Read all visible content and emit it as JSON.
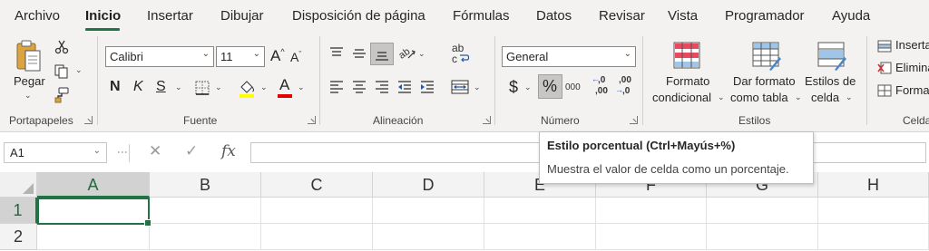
{
  "tabs": [
    "Archivo",
    "Inicio",
    "Insertar",
    "Dibujar",
    "Disposición de página",
    "Fórmulas",
    "Datos",
    "Revisar",
    "Vista",
    "Programador",
    "Ayuda"
  ],
  "active_tab": "Inicio",
  "clipboard": {
    "paste_label": "Pegar",
    "group_label": "Portapapeles"
  },
  "font": {
    "name": "Calibri",
    "size": "11",
    "bold": "N",
    "italic": "K",
    "underline": "S",
    "font_color": "A",
    "grow": "A",
    "shrink": "A",
    "group_label": "Fuente",
    "highlight_color": "#ffff00",
    "font_color_value": "#e00000"
  },
  "alignment": {
    "wrap_glyph": "ab",
    "wrap_glyph2": "c",
    "group_label": "Alineación"
  },
  "number": {
    "format": "General",
    "currency": "$",
    "percent": "%",
    "thousands": "000",
    "inc_decimal_top": ",0",
    "inc_decimal_bottom": ",00",
    "dec_decimal_top": ",00",
    "dec_decimal_bottom": ",0",
    "group_label": "Número"
  },
  "styles": {
    "conditional_label_1": "Formato",
    "conditional_label_2": "condicional",
    "table_label_1": "Dar formato",
    "table_label_2": "como tabla",
    "cell_styles_label_1": "Estilos de",
    "cell_styles_label_2": "celda",
    "group_label": "Estilos"
  },
  "cells_group": {
    "insert": "Insertar",
    "delete": "Eliminar",
    "format": "Formato",
    "group_label": "Celdas"
  },
  "formula_bar": {
    "name_box": "A1",
    "cancel": "✕",
    "enter": "✓",
    "fx": "fx",
    "value": ""
  },
  "grid": {
    "columns": [
      "A",
      "B",
      "C",
      "D",
      "E",
      "F",
      "G",
      "H"
    ],
    "rows": [
      "1",
      "2"
    ],
    "active_cell": "A1"
  },
  "tooltip": {
    "title": "Estilo porcentual (Ctrl+Mayús+%)",
    "description": "Muestra el valor de celda como un porcentaje."
  },
  "colors": {
    "accent": "#217346",
    "ribbon_bg": "#f3f2f1"
  }
}
